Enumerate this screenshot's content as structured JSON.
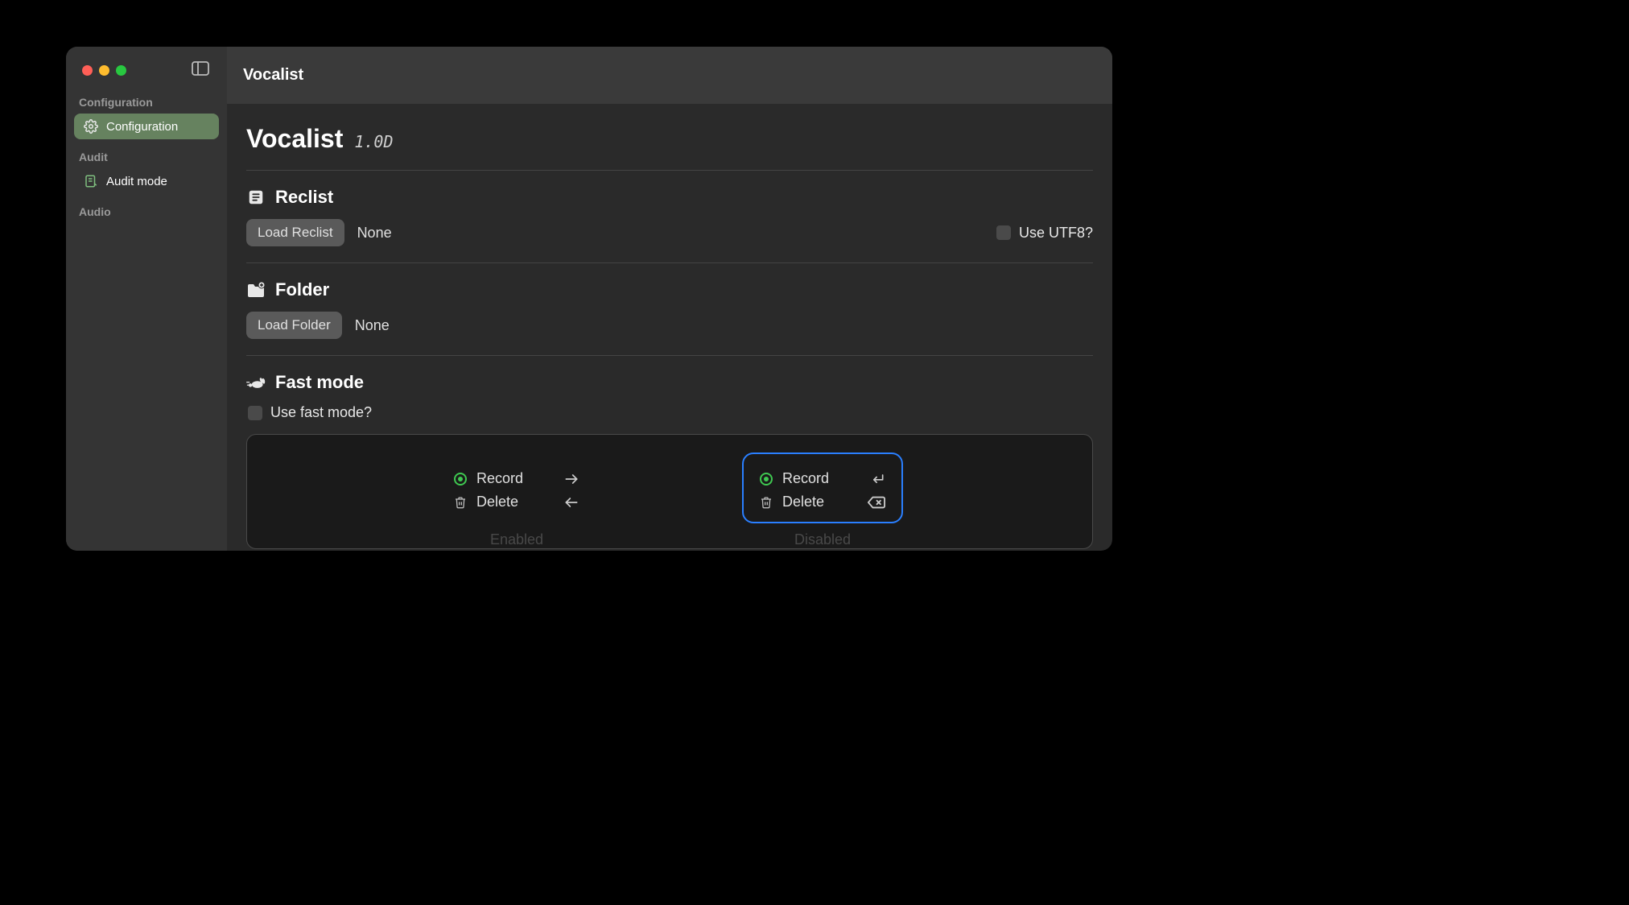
{
  "header": {
    "title": "Vocalist"
  },
  "sidebar": {
    "sections": [
      {
        "label": "Configuration",
        "items": [
          {
            "icon": "gear-icon",
            "label": "Configuration"
          }
        ]
      },
      {
        "label": "Audit",
        "items": [
          {
            "icon": "clipboard-icon",
            "label": "Audit mode"
          }
        ]
      },
      {
        "label": "Audio",
        "items": []
      }
    ]
  },
  "main": {
    "title": "Vocalist",
    "version": "1.0D",
    "reclist": {
      "heading": "Reclist",
      "button": "Load Reclist",
      "value": "None",
      "utf8_label": "Use UTF8?"
    },
    "folder": {
      "heading": "Folder",
      "button": "Load Folder",
      "value": "None"
    },
    "fastmode": {
      "heading": "Fast mode",
      "checkbox_label": "Use fast mode?",
      "enabled": {
        "record": "Record",
        "delete": "Delete",
        "caption": "Enabled"
      },
      "disabled": {
        "record": "Record",
        "delete": "Delete",
        "caption": "Disabled"
      }
    }
  }
}
